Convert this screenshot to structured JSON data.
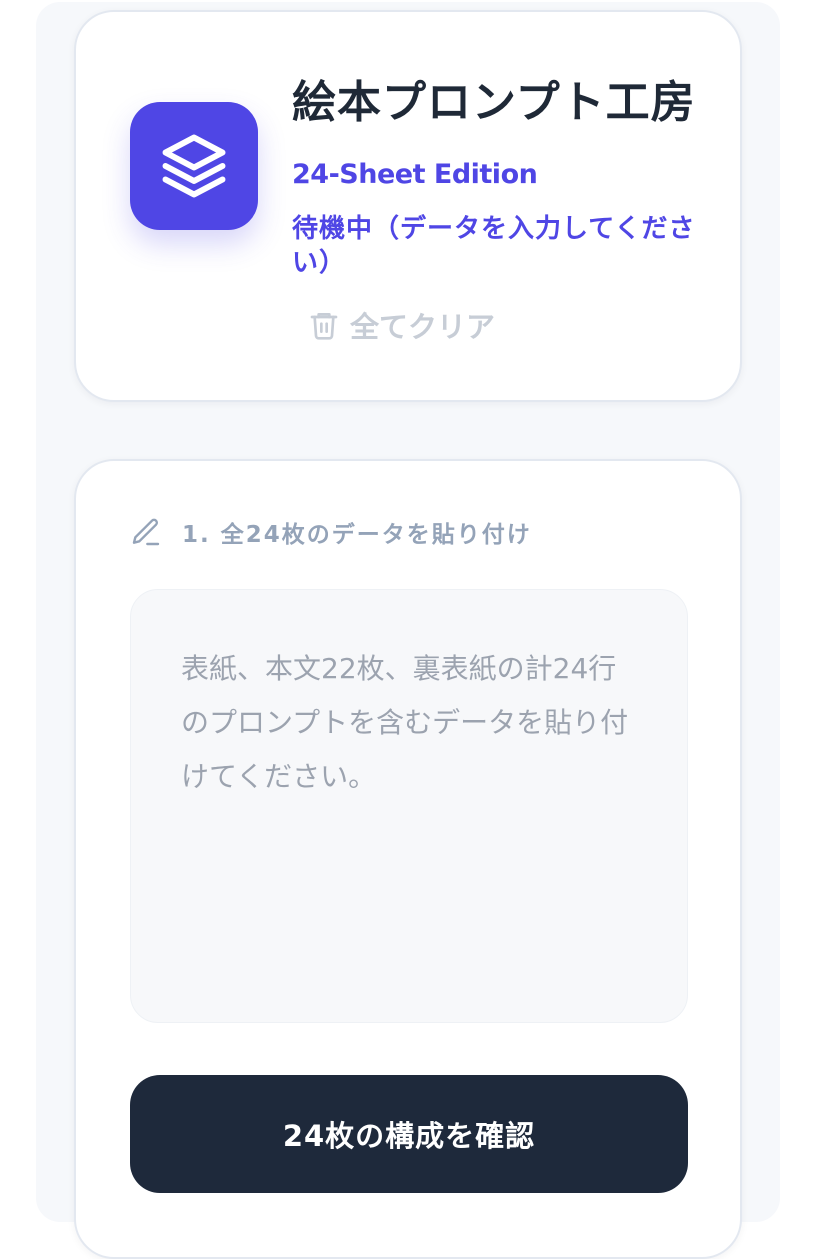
{
  "header": {
    "title": "絵本プロンプト工房",
    "edition": "24-Sheet Edition",
    "status": "待機中（データを入力してください）",
    "clear_label": "全てクリア"
  },
  "input_section": {
    "label": "1. 全24枚のデータを貼り付け",
    "textarea": {
      "value": "",
      "placeholder": "表紙、本文22枚、裏表紙の計24行のプロンプトを含むデータを貼り付けてください。"
    },
    "confirm_label": "24枚の構成を確認"
  },
  "icons": {
    "logo": "layers-icon",
    "clear": "trash-icon",
    "section": "pencil-icon"
  },
  "colors": {
    "accent": "#4f46e5",
    "primary_button": "#1e293b",
    "muted": "#94a3b8",
    "disabled": "#c7cdd6"
  }
}
